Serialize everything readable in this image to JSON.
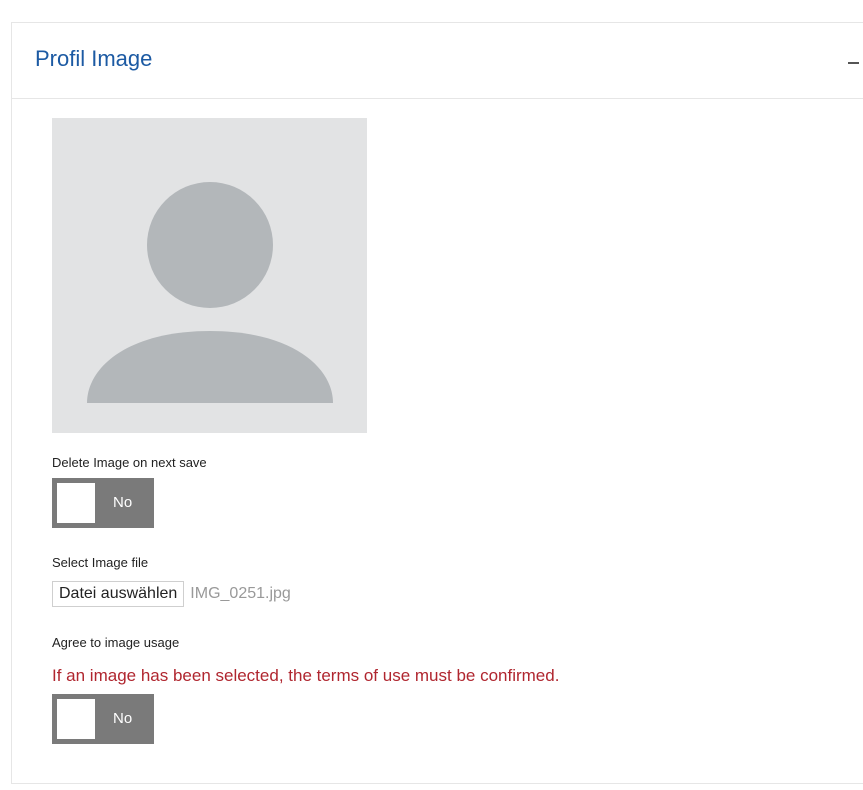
{
  "panel": {
    "title": "Profil Image",
    "collapse_icon": "minus-icon"
  },
  "avatar": {
    "icon": "user-placeholder-icon",
    "colors": {
      "background": "#e2e3e4",
      "silhouette": "#b3b7ba"
    }
  },
  "delete_image": {
    "label": "Delete Image on next save",
    "toggle_state": "No"
  },
  "select_file": {
    "label": "Select Image file",
    "button_label": "Datei auswählen",
    "file_name": "IMG_0251.jpg"
  },
  "agree_usage": {
    "label": "Agree to image usage",
    "error": "If an image has been selected, the terms of use must be confirmed.",
    "toggle_state": "No"
  },
  "colors": {
    "title": "#1c5aa3",
    "error": "#b0262f",
    "toggle": "#7a7a7a",
    "border": "#e6e6e6"
  }
}
